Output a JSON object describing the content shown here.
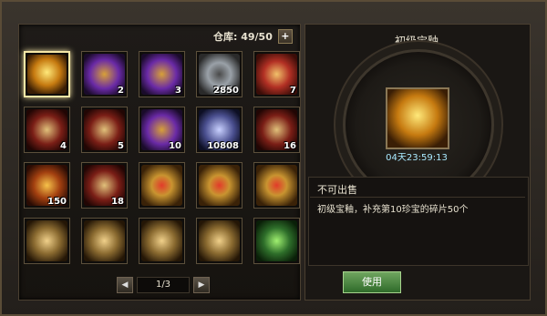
{
  "warehouse": {
    "label": "仓库: 49/50"
  },
  "grid": {
    "slots": [
      {
        "name": "golden-treasure-box",
        "count": "",
        "art": "art-gold",
        "selected": true
      },
      {
        "name": "gold-bars",
        "count": "2",
        "art": "art-purple"
      },
      {
        "name": "gold-pouch",
        "count": "3",
        "art": "art-purple"
      },
      {
        "name": "iron-ingots",
        "count": "2850",
        "art": "art-silver"
      },
      {
        "name": "red-shield",
        "count": "7",
        "art": "art-red"
      },
      {
        "name": "boots",
        "count": "4",
        "art": "art-darkred"
      },
      {
        "name": "armor-green",
        "count": "5",
        "art": "art-darkred"
      },
      {
        "name": "armor-gold",
        "count": "10",
        "art": "art-purple"
      },
      {
        "name": "blue-crystal",
        "count": "10808",
        "art": "art-blue"
      },
      {
        "name": "red-gift",
        "count": "16",
        "art": "art-darkred"
      },
      {
        "name": "red-armor",
        "count": "150",
        "art": "art-orange"
      },
      {
        "name": "dark-armor",
        "count": "18",
        "art": "art-darkred"
      },
      {
        "name": "gold-armor-1",
        "count": "",
        "art": "art-goldarmor"
      },
      {
        "name": "gold-armor-2",
        "count": "",
        "art": "art-goldarmor"
      },
      {
        "name": "gold-medallion",
        "count": "",
        "art": "art-goldarmor"
      },
      {
        "name": "green-armor",
        "count": "",
        "art": "art-tan"
      },
      {
        "name": "gold-armor-3",
        "count": "",
        "art": "art-tan"
      },
      {
        "name": "gold-armor-4",
        "count": "",
        "art": "art-tan"
      },
      {
        "name": "gold-armor-5",
        "count": "",
        "art": "art-tan"
      },
      {
        "name": "green-gem-armor",
        "count": "",
        "art": "art-green"
      }
    ]
  },
  "pager": {
    "page": "1/3"
  },
  "detail": {
    "title": "初级宝釉",
    "timer": "04天23:59:13",
    "no_sell": "不可出售",
    "desc": "初级宝釉，补充第10珍宝的碎片50个",
    "use_label": "使用"
  },
  "icons": {
    "plus": "+",
    "prev": "◀",
    "next": "▶"
  }
}
